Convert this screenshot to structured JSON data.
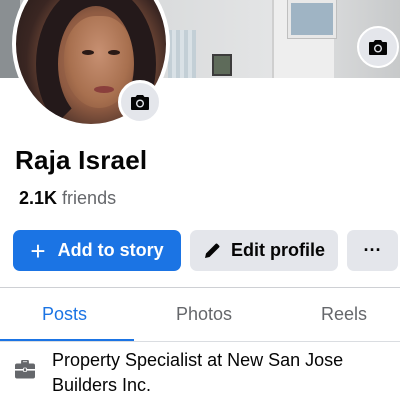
{
  "profile": {
    "name": "Raja Israel",
    "friends_count": "2.1K",
    "friends_label": "friends"
  },
  "actions": {
    "add_story_label": "Add to story",
    "edit_profile_label": "Edit profile",
    "more_label": "···"
  },
  "tabs": [
    {
      "label": "Posts",
      "active": true
    },
    {
      "label": "Photos",
      "active": false
    },
    {
      "label": "Reels",
      "active": false
    }
  ],
  "intro": {
    "work_text": "Property Specialist at New San Jose Builders Inc."
  },
  "colors": {
    "accent": "#1b74e4",
    "button_gray": "#e4e6eb",
    "muted_text": "#65676b"
  },
  "icons": {
    "cover_camera": "camera-icon",
    "avatar_camera": "camera-icon",
    "plus": "plus-icon",
    "pencil": "pencil-icon",
    "work": "briefcase-icon"
  }
}
